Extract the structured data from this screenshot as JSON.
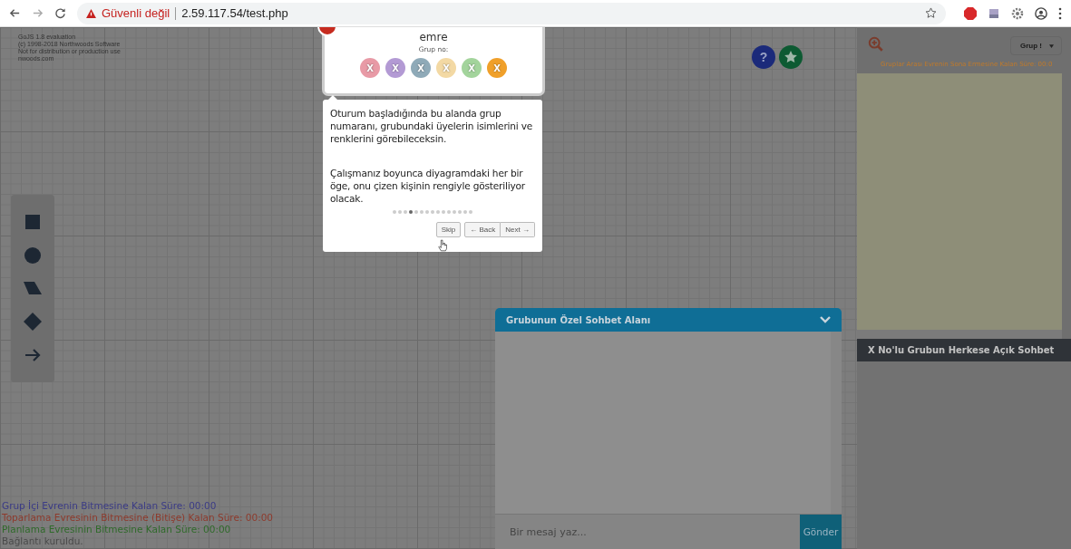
{
  "browser": {
    "security_warning": "Güvenli değil",
    "url": "2.59.117.54/test.php"
  },
  "canvas_notice": [
    "GoJS 1.8 evaluation",
    "(c) 1998-2018 Northwoods Software",
    "Not for distribution or production use",
    "nwoods.com"
  ],
  "members_card": {
    "name": "emre",
    "group_label": "Grup no:",
    "members": [
      {
        "label": "X",
        "color": "#e89aa6"
      },
      {
        "label": "X",
        "color": "#b39ad4"
      },
      {
        "label": "X",
        "color": "#8faab8"
      },
      {
        "label": "X",
        "color": "#f3d9a4"
      },
      {
        "label": "X",
        "color": "#a3d49c"
      },
      {
        "label": "X",
        "color": "#f0a02a"
      }
    ]
  },
  "tour": {
    "paragraphs": [
      "Oturum başladığında bu alanda grup numaranı, grubundaki üyelerin isimlerini ve renklerini görebileceksin.",
      "Çalışmanız boyunca diyagramdaki her bir öge, onu çizen kişinin rengiyle gösteriliyor olacak."
    ],
    "steps": [
      {
        "selected": false
      },
      {
        "selected": false
      },
      {
        "selected": false
      },
      {
        "selected": true
      },
      {
        "selected": false
      },
      {
        "selected": false
      },
      {
        "selected": false
      },
      {
        "selected": false
      },
      {
        "selected": false
      },
      {
        "selected": false
      },
      {
        "selected": false
      },
      {
        "selected": false
      },
      {
        "selected": false
      },
      {
        "selected": false
      },
      {
        "selected": false
      }
    ],
    "skip": "Skip",
    "back": "← Back",
    "next": "Next →"
  },
  "help_glyph": "?",
  "tools": [
    {
      "kind": "rectangle"
    },
    {
      "kind": "circle"
    },
    {
      "kind": "parallelogram"
    },
    {
      "kind": "diamond"
    },
    {
      "kind": "arrow"
    }
  ],
  "status_lines": [
    {
      "text": "Grup İçi Evrenin Bitmesine Kalan Süre: 00:00",
      "color": "#3b3b86"
    },
    {
      "text": "Toparlama Evresinin Bitmesine (Bitişe) Kalan Süre: 00:00",
      "color": "#8e3a2c"
    },
    {
      "text": "Planlama Evresinin Bitmesine Kalan Süre: 00:00",
      "color": "#2f6a2a"
    },
    {
      "text": "Bağlantı kuruldu.",
      "color": "#4a4a4a"
    }
  ],
  "chat": {
    "title": "Grubunun Özel Sohbet Alanı",
    "placeholder": "Bir mesaj yaz...",
    "send": "Gönder"
  },
  "side": {
    "group_select": "Grup !",
    "timer": "Gruplar Arası Evrenin Sona Ermesine Kalan Süre: 00:0",
    "public_chat_title": "X No'lu Grubun Herkese Açık Sohbet"
  }
}
